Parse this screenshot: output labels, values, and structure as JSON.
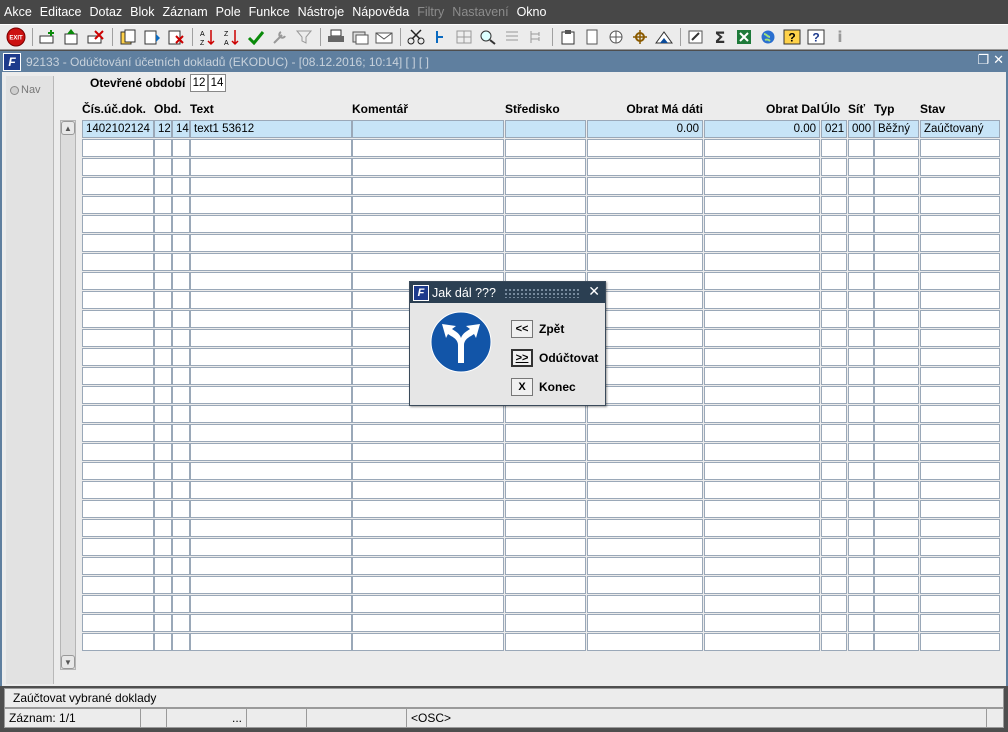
{
  "menu": [
    "Akce",
    "Editace",
    "Dotaz",
    "Blok",
    "Záznam",
    "Pole",
    "Funkce",
    "Nástroje",
    "Nápověda",
    "Filtry",
    "Nastavení",
    "Okno"
  ],
  "menu_disabled": [
    "Filtry",
    "Nastavení"
  ],
  "toolbar": {
    "exit_label": "EXIT",
    "icons": [
      "add-record-icon",
      "insert-icon",
      "delete-record-icon",
      "sep",
      "copy-icon",
      "paste-icon",
      "clear-icon",
      "sep",
      "sort-asc-icon",
      "sort-desc-icon",
      "check-icon",
      "wrench-icon",
      "filter-icon",
      "sep",
      "print-icon",
      "stack-icon",
      "mail-icon",
      "sep",
      "cut-icon",
      "link-icon",
      "grid-icon",
      "zoom-icon",
      "list-icon",
      "tree-icon",
      "sep",
      "doc-icon",
      "page-icon",
      "globe-icon",
      "ship-wheel-icon",
      "triangle-icon",
      "sep",
      "pen-icon",
      "sigma-icon",
      "excel-icon",
      "world-icon",
      "help-icon",
      "help2-icon",
      "info-icon"
    ]
  },
  "window": {
    "title": "92133 - Odúčtování účetních dokladů (EKODUC) - [08.12.2016; 10:14]  [ ]  [ ]"
  },
  "nav": {
    "label": "Nav"
  },
  "period": {
    "label": "Otevřené období",
    "from": "12",
    "to": "14"
  },
  "table": {
    "headers": {
      "doc": "Čís.úč.dok.",
      "obd": "Obd.",
      "text": "Text",
      "komentar": "Komentář",
      "stredisko": "Středisko",
      "md": "Obrat Má dáti",
      "dal": "Obrat Dal",
      "ulo": "Úlo",
      "sit": "Síť",
      "typ": "Typ",
      "stav": "Stav"
    },
    "rows": [
      {
        "doc": "1402102124",
        "obd1": "12",
        "obd2": "14",
        "text": "text1 53612",
        "komentar": "",
        "stredisko": "",
        "md": "0.00",
        "dal": "0.00",
        "ulo": "021",
        "sit": "000",
        "typ": "Běžný",
        "stav": "Zaúčtovaný"
      }
    ]
  },
  "dialog": {
    "title": "Jak dál ???",
    "buttons": [
      {
        "key": "<<",
        "label": "Zpět"
      },
      {
        "key": ">>",
        "label": "Odúčtovat"
      },
      {
        "key": "X",
        "label": "Konec"
      }
    ]
  },
  "status": {
    "hint": "Zaúčtovat vybrané doklady",
    "record": "Záznam: 1/1",
    "ellipsis": "...",
    "mode": "<OSC>"
  },
  "colors": {
    "title_bar": "#5f7f9f",
    "dialog_title": "#2b3f52",
    "selected_row": "#c7e4f7"
  }
}
